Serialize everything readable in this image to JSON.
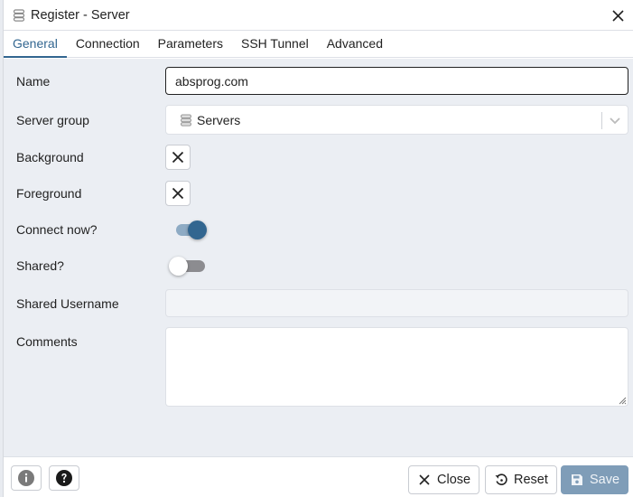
{
  "dialog": {
    "title": "Register - Server",
    "title_icon": "server-icon",
    "close_icon": "close-icon"
  },
  "tabs": [
    {
      "label": "General",
      "active": true
    },
    {
      "label": "Connection",
      "active": false
    },
    {
      "label": "Parameters",
      "active": false
    },
    {
      "label": "SSH Tunnel",
      "active": false
    },
    {
      "label": "Advanced",
      "active": false
    }
  ],
  "form": {
    "name": {
      "label": "Name",
      "value": "absprog.com"
    },
    "server_group": {
      "label": "Server group",
      "value": "Servers",
      "icon": "server-group-icon"
    },
    "background": {
      "label": "Background",
      "icon": "clear-color-icon"
    },
    "foreground": {
      "label": "Foreground",
      "icon": "clear-color-icon"
    },
    "connect_now": {
      "label": "Connect now?",
      "checked": true
    },
    "shared": {
      "label": "Shared?",
      "checked": false
    },
    "shared_username": {
      "label": "Shared Username",
      "value": ""
    },
    "comments": {
      "label": "Comments",
      "value": ""
    }
  },
  "footer": {
    "info_icon": "info-icon",
    "help_icon": "help-icon",
    "close_label": "Close",
    "reset_label": "Reset",
    "save_label": "Save"
  },
  "colors": {
    "accent": "#326690",
    "save_disabled": "#7f9db8",
    "content_bg": "#ebeef3"
  }
}
